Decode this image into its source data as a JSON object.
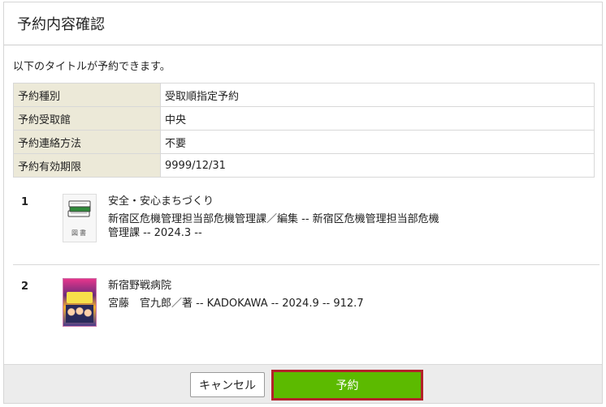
{
  "dialog": {
    "title": "予約内容確認",
    "intro": "以下のタイトルが予約できます。"
  },
  "info": [
    {
      "label": "予約種別",
      "value": "受取順指定予約"
    },
    {
      "label": "予約受取館",
      "value": "中央"
    },
    {
      "label": "予約連絡方法",
      "value": "不要"
    },
    {
      "label": "予約有効期限",
      "value": "9999/12/31"
    }
  ],
  "items": [
    {
      "no": "1",
      "thumb_label": "図書",
      "title": "安全・安心まちづくり",
      "detail": "新宿区危機管理担当部危機管理課／編集 -- 新宿区危機管理担当部危機管理課 -- 2024.3 --"
    },
    {
      "no": "2",
      "title": "新宿野戦病院",
      "detail": "宮藤　官九郎／著 -- KADOKAWA -- 2024.9 -- 912.7"
    }
  ],
  "buttons": {
    "cancel": "キャンセル",
    "reserve": "予約"
  },
  "colors": {
    "reserve_bg": "#5cba00",
    "reserve_border": "#b3222a",
    "label_cell_bg": "#ece9d8"
  },
  "icons": {
    "item1_thumb": "book-stack-icon",
    "item2_thumb": "book-cover-image"
  }
}
